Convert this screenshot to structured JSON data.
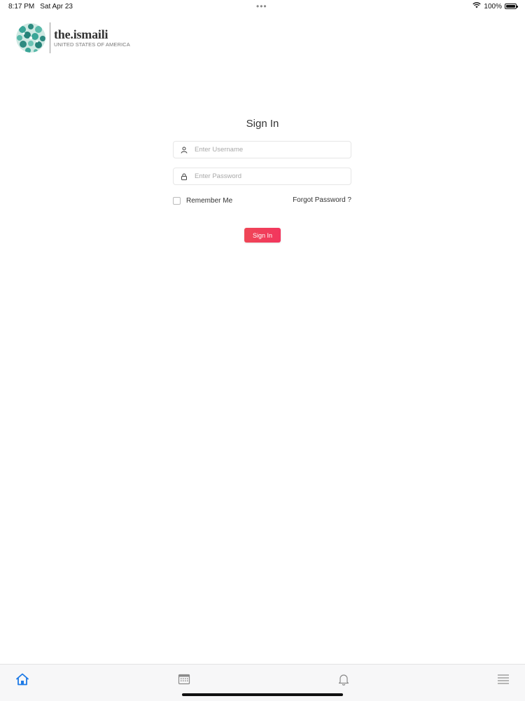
{
  "status_bar": {
    "time": "8:17 PM",
    "date": "Sat Apr 23",
    "more_dots": "•••",
    "battery_text": "100%",
    "battery_level": 1.0
  },
  "logo": {
    "name": "the.ismaili",
    "subtitle": "UNITED STATES OF AMERICA"
  },
  "form": {
    "title": "Sign In",
    "username_placeholder": "Enter Username",
    "username_value": "",
    "password_placeholder": "Enter Password",
    "password_value": "",
    "remember_label": "Remember Me",
    "remember_checked": false,
    "forgot_label": "Forgot Password ?",
    "submit_label": "Sign In"
  },
  "tab_bar": {
    "items": [
      {
        "icon": "home-icon",
        "active": true
      },
      {
        "icon": "calendar-icon",
        "active": false
      },
      {
        "icon": "bell-icon",
        "active": false
      },
      {
        "icon": "menu-icon",
        "active": false
      }
    ]
  },
  "colors": {
    "accent": "#f03f5a",
    "active_tab": "#1e7ae6",
    "inactive_tab": "#8a8a8a"
  }
}
